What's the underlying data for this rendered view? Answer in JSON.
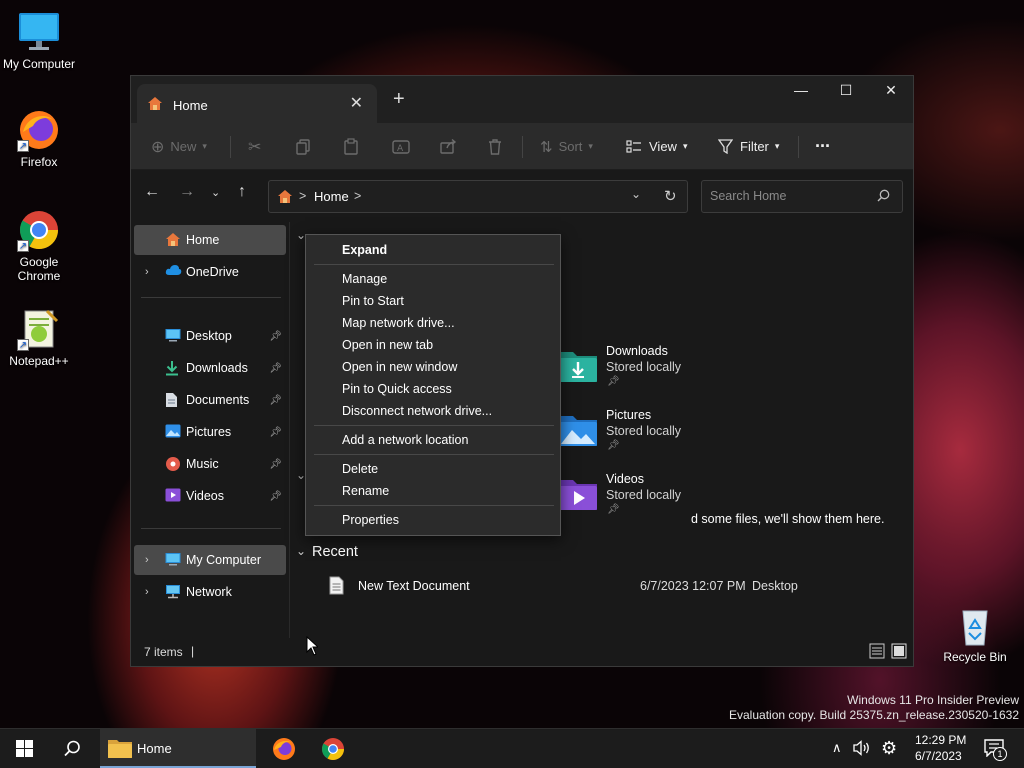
{
  "desktop": {
    "icons": [
      {
        "label": "My Computer"
      },
      {
        "label": "Firefox"
      },
      {
        "label": "Google Chrome"
      },
      {
        "label": "Notepad++"
      },
      {
        "label": "Recycle Bin"
      }
    ],
    "watermark": {
      "line1": "Windows 11 Pro Insider Preview",
      "line2": "Evaluation copy. Build 25375.zn_release.230520-1632"
    }
  },
  "explorer": {
    "tab": {
      "title": "Home",
      "close_icon": "close-icon",
      "new_tab_icon": "plus-icon"
    },
    "toolbar": {
      "new_label": "New",
      "sort_label": "Sort",
      "view_label": "View",
      "filter_label": "Filter",
      "more_label": "···"
    },
    "address": {
      "path": "Home",
      "separator": ">"
    },
    "search": {
      "placeholder": "Search Home"
    },
    "sidebar": {
      "home": "Home",
      "onedrive": "OneDrive",
      "pinned": [
        {
          "label": "Desktop"
        },
        {
          "label": "Downloads"
        },
        {
          "label": "Documents"
        },
        {
          "label": "Pictures"
        },
        {
          "label": "Music"
        },
        {
          "label": "Videos"
        }
      ],
      "my_computer": "My Computer",
      "network": "Network"
    },
    "quick_access": [
      {
        "name": "Downloads",
        "sub": "Stored locally"
      },
      {
        "name": "Pictures",
        "sub": "Stored locally"
      },
      {
        "name": "Videos",
        "sub": "Stored locally"
      }
    ],
    "favorites_hint": "d some files, we'll show them here.",
    "recent": {
      "header": "Recent",
      "rows": [
        {
          "name": "New Text Document",
          "date": "6/7/2023 12:07 PM",
          "location": "Desktop"
        }
      ]
    },
    "status": {
      "items": "7 items",
      "cursor": "|"
    }
  },
  "context_menu": {
    "items": [
      {
        "label": "Expand"
      },
      {
        "label": "Manage"
      },
      {
        "label": "Pin to Start"
      },
      {
        "label": "Map network drive..."
      },
      {
        "label": "Open in new tab"
      },
      {
        "label": "Open in new window"
      },
      {
        "label": "Pin to Quick access"
      },
      {
        "label": "Disconnect network drive..."
      },
      {
        "label": "Add a network location"
      },
      {
        "label": "Delete"
      },
      {
        "label": "Rename"
      },
      {
        "label": "Properties"
      }
    ]
  },
  "taskbar": {
    "explorer_label": "Home",
    "time": "12:29 PM",
    "date": "6/7/2023",
    "notification_count": "1"
  },
  "colors": {
    "accent_blue": "#0078d4",
    "folder_yellow": "#f2c14e",
    "downloads_teal": "#2bb3a0",
    "pictures_blue": "#2f8fe8",
    "videos_purple": "#8a4fd8"
  }
}
